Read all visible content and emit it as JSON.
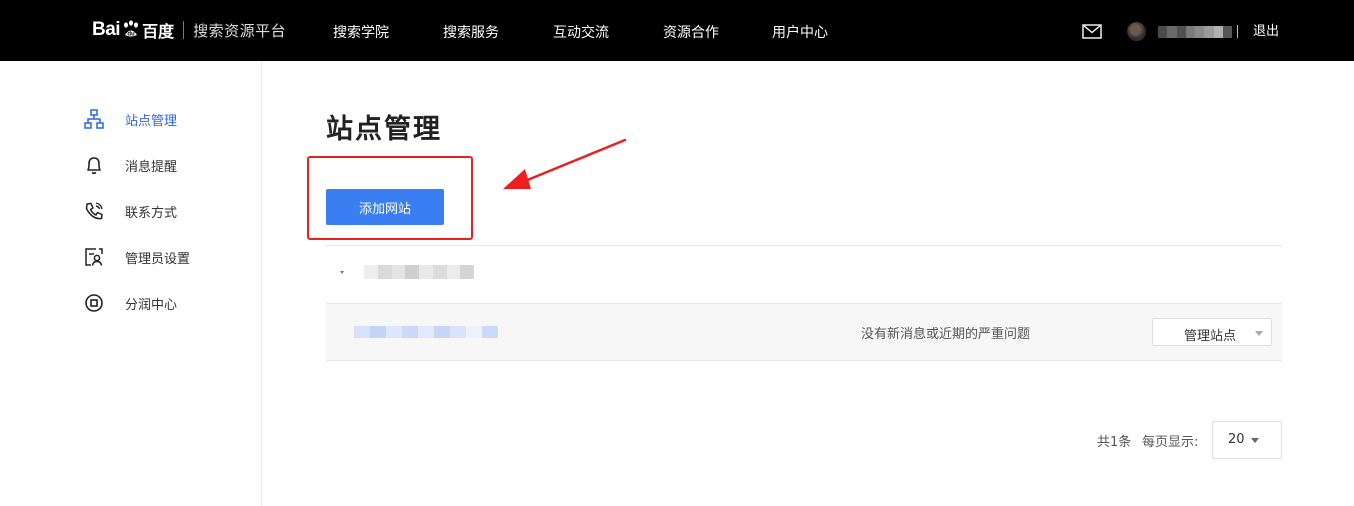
{
  "header": {
    "logo_text_bai": "Bai",
    "logo_text_du": "百度",
    "platform_name": "搜索资源平台",
    "nav": [
      {
        "label": "搜索学院"
      },
      {
        "label": "搜索服务"
      },
      {
        "label": "互动交流"
      },
      {
        "label": "资源合作"
      },
      {
        "label": "用户中心"
      }
    ],
    "logout_label": "退出",
    "icons": {
      "mail": "mail-icon",
      "avatar": "avatar"
    }
  },
  "sidebar": {
    "items": [
      {
        "label": "站点管理",
        "icon": "sitemap-icon",
        "active": true
      },
      {
        "label": "消息提醒",
        "icon": "bell-icon",
        "active": false
      },
      {
        "label": "联系方式",
        "icon": "phone-icon",
        "active": false
      },
      {
        "label": "管理员设置",
        "icon": "admin-card-icon",
        "active": false
      },
      {
        "label": "分润中心",
        "icon": "coin-icon",
        "active": false
      }
    ]
  },
  "main": {
    "title": "站点管理",
    "add_button_label": "添加网站",
    "site": {
      "status_text": "没有新消息或近期的严重问题",
      "manage_label": "管理站点"
    },
    "pagination": {
      "total_text": "共1条",
      "per_page_label": "每页显示:",
      "per_page_value": "20"
    }
  },
  "colors": {
    "topbar": "#000000",
    "accent": "#3a7ef2",
    "active_link": "#2b67e8",
    "annotation_red": "#ef1e1e"
  }
}
